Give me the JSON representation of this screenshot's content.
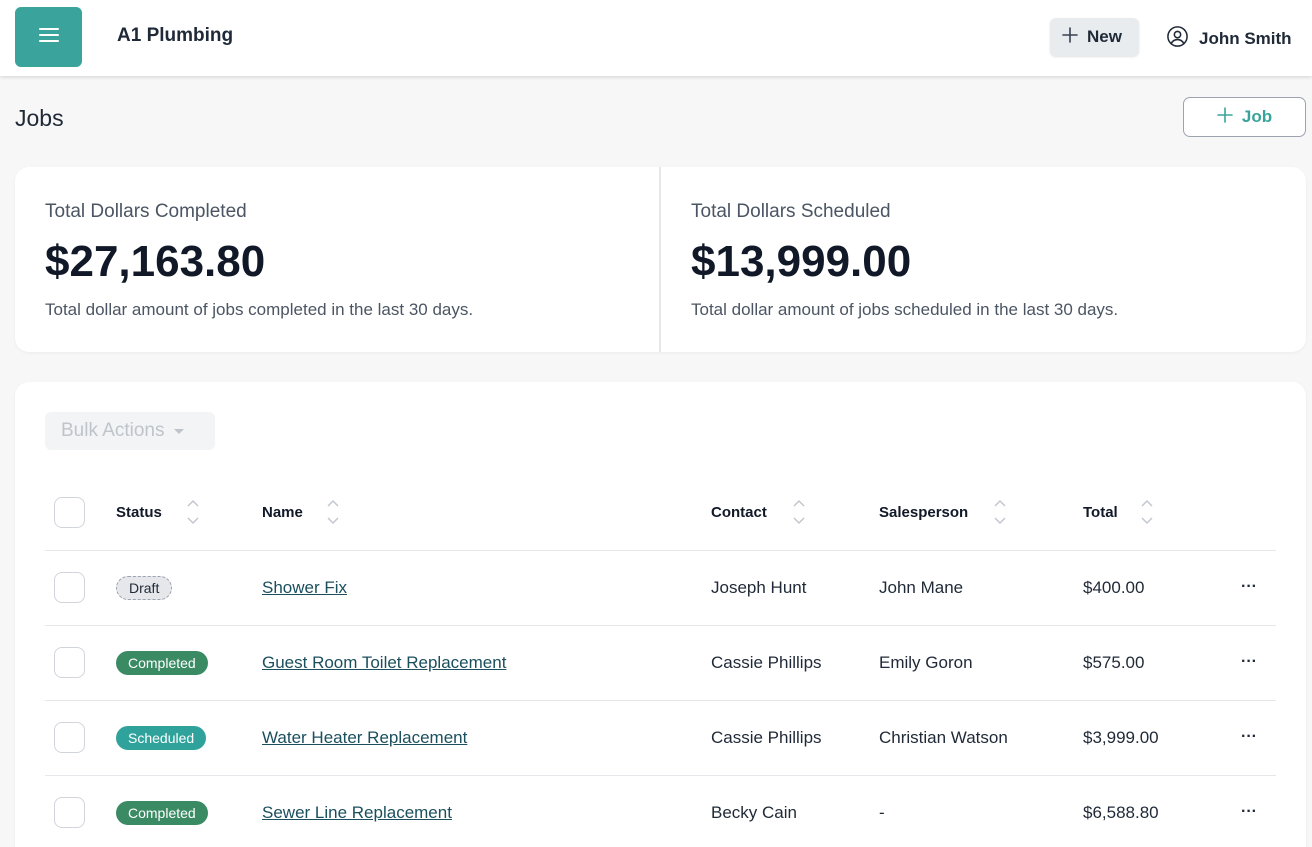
{
  "header": {
    "app_title": "A1 Plumbing",
    "new_label": "New",
    "user_name": "John Smith"
  },
  "page": {
    "title": "Jobs",
    "add_job_label": "Job"
  },
  "stats": [
    {
      "label": "Total Dollars Completed",
      "value": "$27,163.80",
      "description": "Total dollar amount of jobs completed in the last 30 days."
    },
    {
      "label": "Total Dollars Scheduled",
      "value": "$13,999.00",
      "description": "Total dollar amount of jobs scheduled in the last 30 days."
    }
  ],
  "table": {
    "bulk_actions_label": "Bulk Actions",
    "columns": [
      "Status",
      "Name",
      "Contact",
      "Salesperson",
      "Total"
    ],
    "rows": [
      {
        "status": "Draft",
        "name": "Shower Fix",
        "contact": "Joseph Hunt",
        "salesperson": "John Mane",
        "total": "$400.00",
        "more": "···"
      },
      {
        "status": "Completed",
        "name": "Guest Room Toilet Replacement",
        "contact": "Cassie Phillips",
        "salesperson": "Emily Goron",
        "total": "$575.00",
        "more": "···"
      },
      {
        "status": "Scheduled",
        "name": "Water Heater Replacement",
        "contact": "Cassie Phillips",
        "salesperson": "Christian Watson",
        "total": "$3,999.00",
        "more": "···"
      },
      {
        "status": "Completed",
        "name": "Sewer Line Replacement",
        "contact": "Becky Cain",
        "salesperson": "-",
        "total": "$6,588.80",
        "more": "···"
      }
    ]
  },
  "colors": {
    "accent": "#3aa39b",
    "completed": "#3a8a64",
    "scheduled": "#2fa39b",
    "link": "#1b4f5e"
  },
  "icons": {
    "menu": "hamburger-menu-icon",
    "plus": "plus-icon",
    "user": "user-circle-icon",
    "sort": "sort-icon",
    "caret": "caret-down-icon"
  }
}
